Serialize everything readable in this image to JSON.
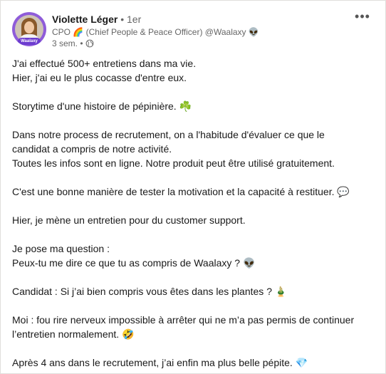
{
  "post": {
    "author": {
      "name": "Violette Léger",
      "separator": "•",
      "degree": "1er",
      "headline": "CPO 🌈 (Chief People & Peace Officer) @Waalaxy 👽",
      "time": "3 sem.",
      "meta_separator": "•",
      "avatar_badge": "Waalaxy"
    },
    "more_menu": "•••",
    "icons": {
      "globe": "globe-icon",
      "more": "more-options-icon"
    },
    "body": {
      "lines": [
        "J'ai effectué 500+ entretiens dans ma vie.",
        "Hier, j'ai eu le plus cocasse d'entre eux.",
        "",
        "Storytime d'une histoire de pépinière. ☘️",
        "",
        "Dans notre process de recrutement, on a l'habitude d'évaluer ce que le",
        "candidat a compris de notre activité.",
        "Toutes les infos sont en ligne. Notre produit peut être utilisé gratuitement.",
        "",
        "C'est une bonne manière de tester la motivation et la capacité à restituer. 💬",
        "",
        "Hier, je mène un entretien pour du customer support.",
        "",
        "Je pose ma question :",
        "Peux-tu me dire ce que tu as compris de Waalaxy ? 👽",
        "",
        "Candidat : Si j’ai bien compris vous êtes dans les plantes ? 🎍",
        "",
        "Moi : fou rire nerveux impossible à arrêter qui ne m’a pas permis de continuer",
        "l’entretien normalement. 🤣",
        "",
        "Après 4 ans dans le recrutement, j’ai enfin ma plus belle pépite. 💎"
      ]
    },
    "colors": {
      "text": "#191919",
      "secondary": "#666666",
      "border": "#e0dfdc",
      "avatar_ring": "#8f5cd9"
    }
  }
}
